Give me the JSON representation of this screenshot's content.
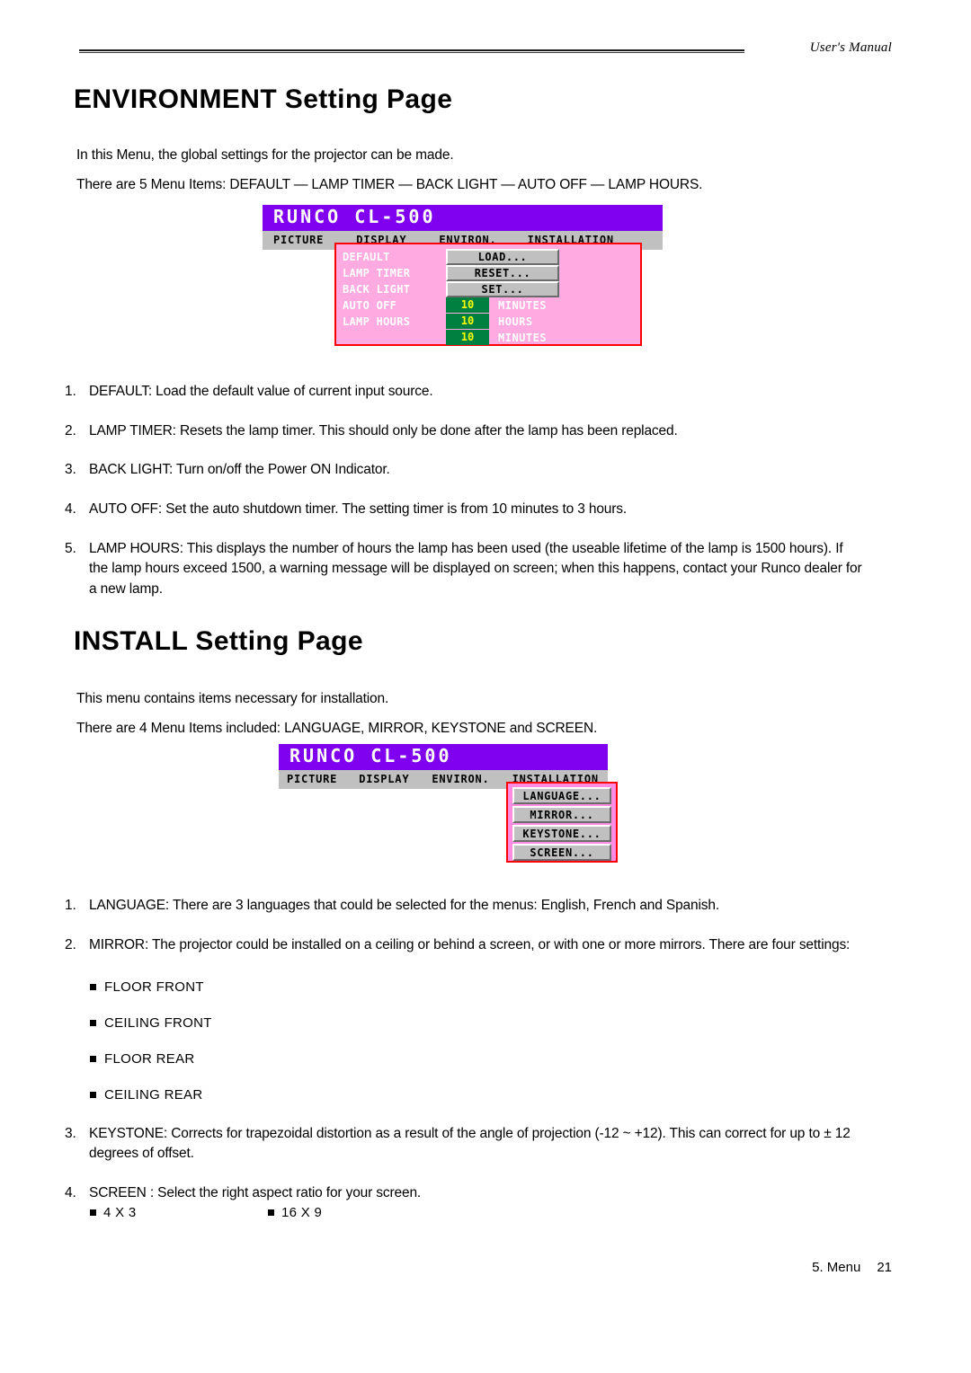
{
  "header": {
    "manual_label": "User's Manual"
  },
  "sections": {
    "environment": {
      "title": "ENVIRONMENT Setting Page",
      "intro": "In this Menu, the global settings for the projector can be made.",
      "items_line": "There are 5 Menu Items: DEFAULT — LAMP TIMER — BACK LIGHT — AUTO OFF — LAMP HOURS.",
      "numbered": [
        {
          "num": "1.",
          "text": "DEFAULT: Load the default value of current input source."
        },
        {
          "num": "2.",
          "text": "LAMP TIMER: Resets the lamp timer. This should only be done after the lamp has been replaced."
        },
        {
          "num": "3.",
          "text": "BACK LIGHT: Turn on/off the Power ON Indicator."
        },
        {
          "num": "4.",
          "text": "AUTO OFF: Set the auto shutdown timer. The setting timer is from 10 minutes to 3 hours."
        },
        {
          "num": "5.",
          "text": "LAMP HOURS: This displays the number of hours the lamp has been used (the useable lifetime of the lamp is 1500 hours). If the lamp hours exceed 1500, a warning message will be displayed on screen; when this happens, contact your Runco dealer for a new lamp."
        }
      ]
    },
    "install": {
      "title": "INSTALL Setting Page",
      "intro": "This menu contains items necessary for installation.",
      "items_line": "There are 4 Menu Items included: LANGUAGE, MIRROR, KEYSTONE and SCREEN.",
      "numbered": [
        {
          "num": "1.",
          "text": "LANGUAGE: There are 3 languages that could be selected for the menus: English, French and Spanish."
        },
        {
          "num": "2.",
          "text": "MIRROR: The projector could be installed on a ceiling or behind a screen, or with one or more mirrors. There are four settings:"
        },
        {
          "num": "3.",
          "text": "KEYSTONE: Corrects for trapezoidal distortion as a result of the angle of projection (-12 ~ +12). This can correct for up to ± 12 degrees of offset."
        },
        {
          "num": "4.",
          "text": "SCREEN : Select the right aspect ratio for your screen."
        }
      ],
      "mirror_options": [
        "FLOOR FRONT",
        "CEILING FRONT",
        "FLOOR REAR",
        "CEILING REAR"
      ],
      "screen_ratios": [
        "4 X 3",
        "16 X 9"
      ]
    }
  },
  "osd_environment": {
    "title": "RUNCO CL-500",
    "menubar": [
      "PICTURE",
      "DISPLAY",
      "ENVIRON.",
      "INSTALLATION"
    ],
    "rows": [
      {
        "label": "DEFAULT",
        "control": "button",
        "value": "LOAD..."
      },
      {
        "label": "LAMP TIMER",
        "control": "button",
        "value": "RESET..."
      },
      {
        "label": "BACK LIGHT",
        "control": "button",
        "value": "SET..."
      },
      {
        "label": "AUTO OFF",
        "control": "value",
        "value": "10",
        "unit": "MINUTES"
      },
      {
        "label": "LAMP HOURS",
        "control": "value",
        "value": "10",
        "unit": "HOURS"
      },
      {
        "label": "",
        "control": "value",
        "value": "10",
        "unit": "MINUTES"
      }
    ],
    "colors": {
      "titlebar": "#8000F0",
      "menubar": "#C0C0C0",
      "panel_bg": "#FFAAE0",
      "panel_border": "#FF0000",
      "value_bg": "#008040",
      "value_text": "#FFFF00"
    }
  },
  "osd_install": {
    "title": "RUNCO CL-500",
    "menubar": [
      "PICTURE",
      "DISPLAY",
      "ENVIRON.",
      "INSTALLATION"
    ],
    "buttons": [
      "LANGUAGE...",
      "MIRROR...",
      "KEYSTONE...",
      "SCREEN..."
    ],
    "colors": {
      "titlebar": "#8000F0",
      "menubar": "#C0C0C0",
      "panel_bg": "#FF8CE0",
      "panel_border": "#FF0000"
    }
  },
  "footer": {
    "chapter": "5. Menu",
    "page_number": "21"
  }
}
